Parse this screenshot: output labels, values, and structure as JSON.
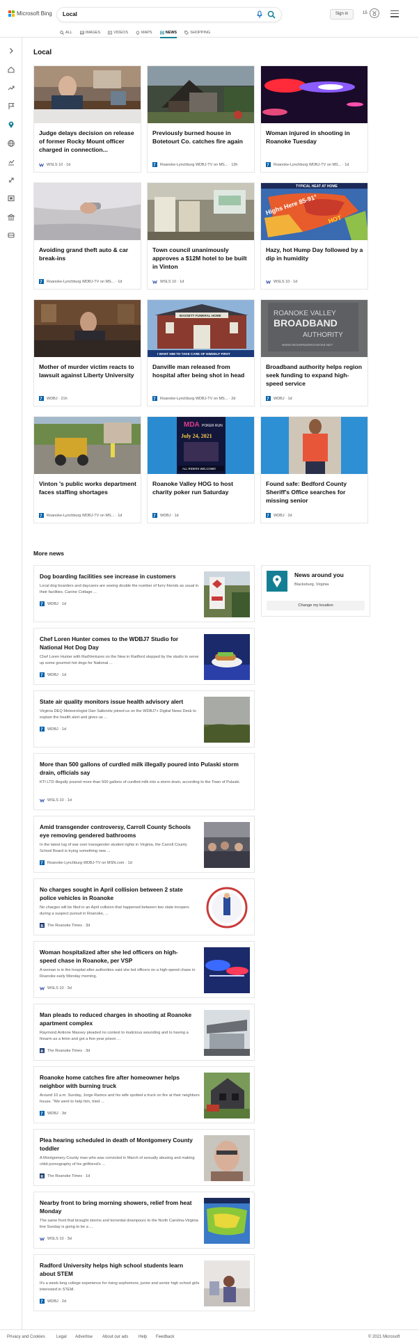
{
  "header": {
    "logo_text": "Microsoft Bing",
    "search_value": "Local",
    "signin_label": "Sign in",
    "rewards_points": "15",
    "tabs": [
      {
        "label": "ALL",
        "icon": "search-icon"
      },
      {
        "label": "IMAGES",
        "icon": "image-icon"
      },
      {
        "label": "VIDEOS",
        "icon": "video-icon"
      },
      {
        "label": "MAPS",
        "icon": "map-pin-icon"
      },
      {
        "label": "NEWS",
        "icon": "news-icon",
        "active": true
      },
      {
        "label": "SHOPPING",
        "icon": "shopping-tag-icon"
      }
    ]
  },
  "local": {
    "heading": "Local",
    "cards": [
      {
        "title": "Judge delays decision on release of former Rocky Mount officer charged in connection...",
        "source": "WSLS 10",
        "age": "1d",
        "logo": "wsls"
      },
      {
        "title": "Previously burned house in Botetourt Co. catches fire again",
        "source": "Roanoke-Lynchburg WDBJ-TV on MS...",
        "age": "13h",
        "logo": "wdbj"
      },
      {
        "title": "Woman injured in shooting in Roanoke Tuesday",
        "source": "Roanoke-Lynchburg WDBJ-TV on MS...",
        "age": "1d",
        "logo": "wdbj"
      },
      {
        "title": "Avoiding grand theft auto & car break-ins",
        "source": "Roanoke-Lynchburg WDBJ-TV on MS...",
        "age": "1d",
        "logo": "wdbj"
      },
      {
        "title": "Town council unanimously approves a $12M hotel to be built in Vinton",
        "source": "WSLS 10",
        "age": "1d",
        "logo": "wsls"
      },
      {
        "title": "Hazy, hot Hump Day followed by a dip in humidity",
        "source": "WSLS 10",
        "age": "1d",
        "logo": "wsls"
      },
      {
        "title": "Mother of murder victim reacts to lawsuit against Liberty University",
        "source": "WDBJ",
        "age": "21h",
        "logo": "wdbj"
      },
      {
        "title": "Danville man released from hospital after being shot in head",
        "source": "Roanoke-Lynchburg WDBJ-TV on MS...",
        "age": "2d",
        "logo": "wdbj"
      },
      {
        "title": "Broadband authority helps region seek funding to expand high-speed service",
        "source": "WDBJ",
        "age": "1d",
        "logo": "wdbj"
      },
      {
        "title": "Vinton 's public works department faces staffing shortages",
        "source": "Roanoke-Lynchburg WDBJ-TV on MS...",
        "age": "1d",
        "logo": "wdbj"
      },
      {
        "title": "Roanoke Valley HOG to host charity poker run Saturday",
        "source": "WDBJ",
        "age": "1d",
        "logo": "wdbj"
      },
      {
        "title": "Found safe: Bedford County Sheriff's Office searches for missing senior",
        "source": "WDBJ",
        "age": "2d",
        "logo": "wdbj"
      }
    ],
    "image_text": {
      "weather_banner": "TYPICAL HEAT AT HOME",
      "weather_highs": "Highs Here 85-91°",
      "weather_hot": "HOT",
      "broadband_sign_1": "ROANOKE VALLEY",
      "broadband_sign_2": "BROADBAND",
      "broadband_sign_3": "AUTHORITY",
      "broadband_sign_url": "WWW.HIGHSPEEDROANOKE.NET",
      "danville_sign": "BASSETT FUNERAL HOME",
      "danville_banner": "I WANT HIM TO TAKE CARE OF HIMSELF FIRST",
      "poker_org": "MDA",
      "poker_title": "POKER RUN",
      "poker_date": "July 24, 2021",
      "poker_footer": "ALL RIDERS WELCOME!"
    }
  },
  "more_news": {
    "heading": "More news",
    "items": [
      {
        "title": "Dog boarding facilities see increase in customers",
        "desc": "Local dog boarders and daycares are seeing double the number of furry friends as usual in their facilities. Canine Cottage ...",
        "source": "WDBJ",
        "age": "1d",
        "logo": "wdbj",
        "img": true
      },
      {
        "title": "Chef Loren Hunter comes to the WDBJ7 Studio for National Hot Dog Day",
        "desc": "Chef Loren Hunter with RadVentures on the New in Radford stopped by the studio to serve up some gourmet hot dogs for National ...",
        "source": "WDBJ",
        "age": "1d",
        "logo": "wdbj",
        "img": true
      },
      {
        "title": "State air quality monitors issue health advisory alert",
        "desc": "Virginia DEQ Meteorologist Dan Salkovitz joined us on the WDBJ7+ Digital News Desk to explain the health alert and gives us ...",
        "source": "WDBJ",
        "age": "1d",
        "logo": "wdbj",
        "img": true
      },
      {
        "title": "More than 500 gallons of curdled milk illegally poured into Pulaski storm drain, officials say",
        "desc": "KTI LTD illegally poured more than 500 gallons of curdled milk into a storm drain, according to the Town of Pulaski.",
        "source": "WSLS 10",
        "age": "1d",
        "logo": "wsls",
        "img": false
      },
      {
        "title": "Amid transgender controversy, Carroll County Schools eye removing gendered bathrooms",
        "desc": "In the latest tug of war over transgender student rights in Virginia, the Carroll County School Board is trying something new ...",
        "source": "Roanoke-Lynchburg WDBJ-TV on MSN.com",
        "age": "1d",
        "logo": "wdbj",
        "img": true
      },
      {
        "title": "No charges sought in April collision between 2 state police vehicles in Roanoke",
        "desc": "No charges will be filed in an April collision that happened between two state troopers during a suspect pursuit in Roanoke, ...",
        "source": "The Roanoke Times",
        "age": "3d",
        "logo": "rt",
        "img": true
      },
      {
        "title": "Woman hospitalized after she led officers on high-speed chase in Roanoke, per VSP",
        "desc": "A woman is in the hospital after authorities said she led officers on a high-speed chase in Roanoke early Monday morning.",
        "source": "WSLS 10",
        "age": "3d",
        "logo": "wsls",
        "img": true
      },
      {
        "title": "Man pleads to reduced charges in shooting at Roanoke apartment complex",
        "desc": "Raymond Antione Massey pleaded no contest to malicious wounding and to having a firearm as a felon and got a five-year prison ...",
        "source": "The Roanoke Times",
        "age": "3d",
        "logo": "rt",
        "img": true
      },
      {
        "title": "Roanoke home catches fire after homeowner helps neighbor with burning truck",
        "desc": "Around 10 a.m. Sunday, Jorge Ramos and his wife spotted a truck on fire at their neighbors house. \"We went to help him, tried ...",
        "source": "WDBJ",
        "age": "3d",
        "logo": "wdbj",
        "img": true
      },
      {
        "title": "Plea hearing scheduled in death of Montgomery County toddler",
        "desc": "A Montgomery County man who was convicted in March of sexually abusing and making child pornography of his girlfriend's ...",
        "source": "The Roanoke Times",
        "age": "1d",
        "logo": "rt",
        "img": true
      },
      {
        "title": "Nearby front to bring morning showers, relief from heat Monday",
        "desc": "The same front that brought storms and torrential downpours to the North Carolina-Virginia line Sunday is going to be a ...",
        "source": "WSLS 10",
        "age": "3d",
        "logo": "wsls",
        "img": true
      },
      {
        "title": "Radford University helps high school students learn about STEM",
        "desc": "It's a week-long college experience for rising sophomore, junior and senior high school girls interested in STEM.",
        "source": "WDBJ",
        "age": "2d",
        "logo": "wdbj",
        "img": true
      }
    ]
  },
  "news_around": {
    "title": "News around you",
    "location": "Blacksburg, Virginia",
    "button": "Change my location"
  },
  "footer": {
    "links": [
      "Privacy and Cookies",
      "Legal",
      "Advertise",
      "About our ads",
      "Help",
      "Feedback"
    ],
    "copyright": "© 2021 Microsoft"
  },
  "colors": {
    "accent": "#147f94",
    "ms_red": "#f25022",
    "ms_green": "#7fba00",
    "ms_blue": "#00a4ef",
    "ms_yellow": "#ffb900",
    "search_icon": "#1a73c8"
  }
}
